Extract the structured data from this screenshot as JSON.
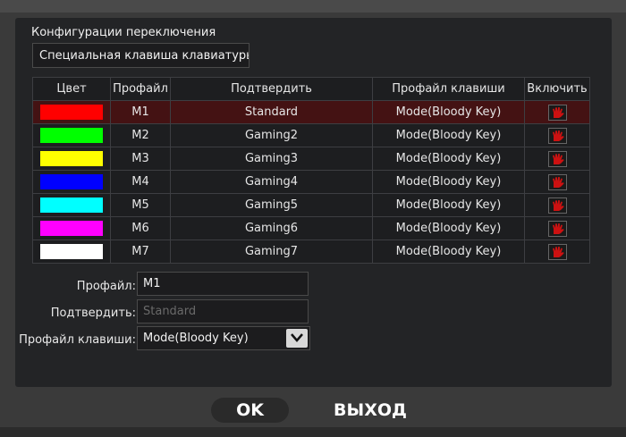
{
  "config_title": "Конфигурации переключения",
  "special_key": {
    "value": "Специальная клавиша клавиатуры"
  },
  "table": {
    "headers": {
      "color": "Цвет",
      "profile": "Профайл",
      "confirm": "Подтвердить",
      "key_profile": "Профайл клавиши",
      "enable": "Включить"
    },
    "rows": [
      {
        "color": "#ff0000",
        "profile": "M1",
        "confirm": "Standard",
        "key_profile": "Mode(Bloody Key)",
        "selected": true
      },
      {
        "color": "#00ff00",
        "profile": "M2",
        "confirm": "Gaming2",
        "key_profile": "Mode(Bloody Key)"
      },
      {
        "color": "#ffff00",
        "profile": "M3",
        "confirm": "Gaming3",
        "key_profile": "Mode(Bloody Key)"
      },
      {
        "color": "#0000ff",
        "profile": "M4",
        "confirm": "Gaming4",
        "key_profile": "Mode(Bloody Key)"
      },
      {
        "color": "#00ffff",
        "profile": "M5",
        "confirm": "Gaming5",
        "key_profile": "Mode(Bloody Key)"
      },
      {
        "color": "#ff00ff",
        "profile": "M6",
        "confirm": "Gaming6",
        "key_profile": "Mode(Bloody Key)"
      },
      {
        "color": "#ffffff",
        "profile": "M7",
        "confirm": "Gaming7",
        "key_profile": "Mode(Bloody Key)"
      }
    ],
    "enable_icon": "bloody-hand-icon",
    "accent_color": "#cc1111"
  },
  "form": {
    "profile_label": "Профайл:",
    "profile_value": "M1",
    "confirm_label": "Подтвердить:",
    "confirm_value": "Standard",
    "key_profile_label": "Профайл клавиши:",
    "key_profile_value": "Mode(Bloody Key)"
  },
  "buttons": {
    "ok": "OK",
    "exit": "ВЫХОД"
  }
}
